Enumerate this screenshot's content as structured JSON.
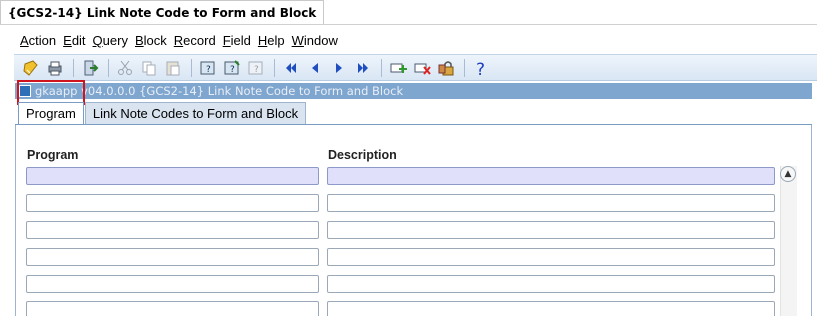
{
  "window": {
    "title": "{GCS2-14} Link Note Code to Form and Block"
  },
  "menu": [
    {
      "accel": "A",
      "rest": "ction"
    },
    {
      "accel": "E",
      "rest": "dit"
    },
    {
      "accel": "Q",
      "rest": "uery"
    },
    {
      "accel": "B",
      "rest": "lock"
    },
    {
      "accel": "R",
      "rest": "ecord"
    },
    {
      "accel": "F",
      "rest": "ield"
    },
    {
      "accel": "H",
      "rest": "elp"
    },
    {
      "accel": "W",
      "rest": "indow"
    }
  ],
  "toolbar": {
    "icons": [
      "save-icon",
      "print-icon",
      "exit-icon",
      "cut-icon",
      "copy-icon",
      "paste-icon",
      "enter-query-icon",
      "execute-query-icon",
      "cancel-query-icon",
      "first-record-icon",
      "previous-record-icon",
      "next-record-icon",
      "last-record-icon",
      "insert-record-icon",
      "delete-record-icon",
      "lock-record-icon",
      "help-icon"
    ]
  },
  "form": {
    "title": "gkaapp  v04.0.0.0  {GCS2-14} Link Note Code to  Form and Block"
  },
  "tabs": [
    {
      "label": "Program",
      "active": true
    },
    {
      "label": "Link Note Codes to Form and Block",
      "active": false
    }
  ],
  "grid": {
    "columns": [
      "Program",
      "Description"
    ],
    "rows": 6
  },
  "colors": {
    "titlebar": "#7fa6cf",
    "selected_row": "#e0e0fb",
    "highlight_box": "#d0141d"
  }
}
